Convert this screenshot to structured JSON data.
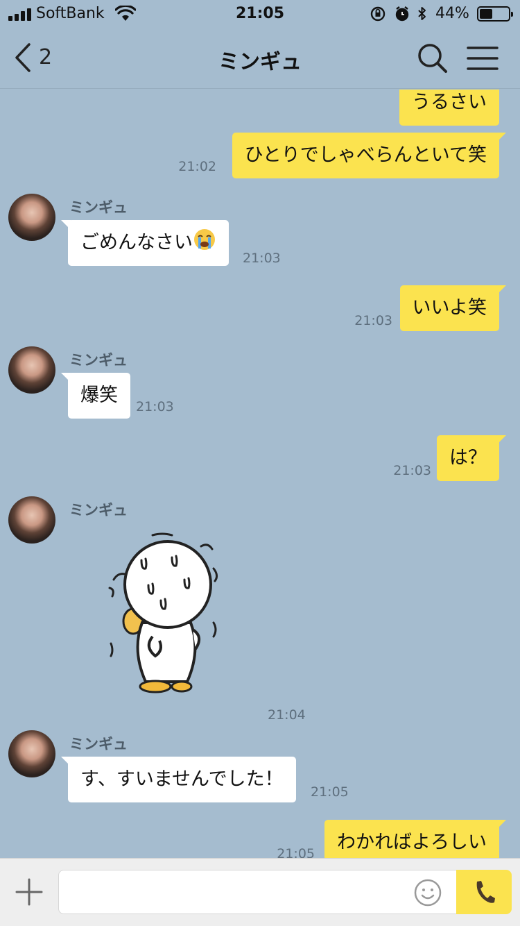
{
  "status_bar": {
    "carrier": "SoftBank",
    "time": "21:05",
    "battery_percent": "44%",
    "battery_level": 0.44
  },
  "header": {
    "back_count": "2",
    "title": "ミンギュ",
    "back_icon": "chevron-left-icon",
    "search_icon": "search-icon",
    "menu_icon": "hamburger-menu-icon"
  },
  "messages": [
    {
      "dir": "out",
      "text": "うるさい",
      "time": ""
    },
    {
      "dir": "out",
      "text": "ひとりでしゃべらんといて笑",
      "time": "21:02"
    },
    {
      "dir": "in",
      "sender": "ミンギュ",
      "text": "ごめんなさい",
      "emoji": "loudly-crying-face",
      "time": "21:03"
    },
    {
      "dir": "out",
      "text": "いいよ笑",
      "time": "21:03"
    },
    {
      "dir": "in",
      "sender": "ミンギュ",
      "text": "爆笑",
      "time": "21:03"
    },
    {
      "dir": "out",
      "text": "は？",
      "time": "21:03"
    },
    {
      "dir": "in",
      "sender": "ミンギュ",
      "sticker": "trembling-white-character-sticker",
      "time": "21:04"
    },
    {
      "dir": "in",
      "sender": "ミンギュ",
      "text": "す、すいませんでした！",
      "time": "21:05"
    },
    {
      "dir": "out",
      "text": "わかればよろしい",
      "time": "21:05"
    }
  ],
  "input_bar": {
    "plus_icon": "plus-icon",
    "value": "",
    "emoji_icon": "smiley-icon",
    "call_icon": "phone-icon"
  },
  "colors": {
    "background": "#a5bccf",
    "outgoing_bubble": "#fbe34f",
    "incoming_bubble": "#ffffff",
    "input_bar": "#eeeeee"
  }
}
